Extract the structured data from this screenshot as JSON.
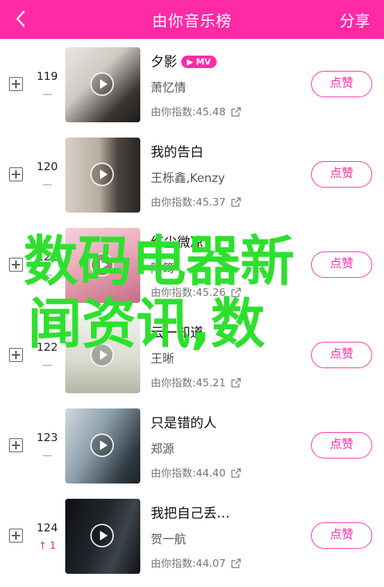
{
  "header": {
    "title": "由你音乐榜",
    "share_label": "分享",
    "background_color": "#ff2aa6"
  },
  "songs": [
    {
      "rank": "119",
      "trend": "—",
      "title": "夕影",
      "badge": "MV",
      "singer": "萧忆情",
      "index": "由你指数:45.48",
      "like_label": "点赞"
    },
    {
      "rank": "120",
      "trend": "—",
      "title": "我的告白",
      "badge": "",
      "singer": "王栎鑫,Kenzy",
      "index": "由你指数:45.37",
      "like_label": "点赞"
    },
    {
      "rank": "121",
      "trend": "—",
      "title": "红尘微凉",
      "badge": "",
      "singer": "陆筠",
      "index": "由你指数:45.26",
      "like_label": "点赞"
    },
    {
      "rank": "122",
      "trend": "—",
      "title": "云一知道",
      "badge": "",
      "singer": "王晰",
      "index": "由你指数:45.21",
      "like_label": "点赞"
    },
    {
      "rank": "123",
      "trend": "—",
      "title": "只是错的人",
      "badge": "",
      "singer": "郑源",
      "index": "由你指数:44.40",
      "like_label": "点赞"
    },
    {
      "rank": "124",
      "trend": "↑ 1",
      "title": "我把自己丢…",
      "badge": "",
      "singer": "贺一航",
      "index": "由你指数:44.07",
      "like_label": "点赞"
    }
  ],
  "overlay": {
    "line1": "数码电器新",
    "line2": "闻资讯,数",
    "color": "#2ee02e"
  }
}
